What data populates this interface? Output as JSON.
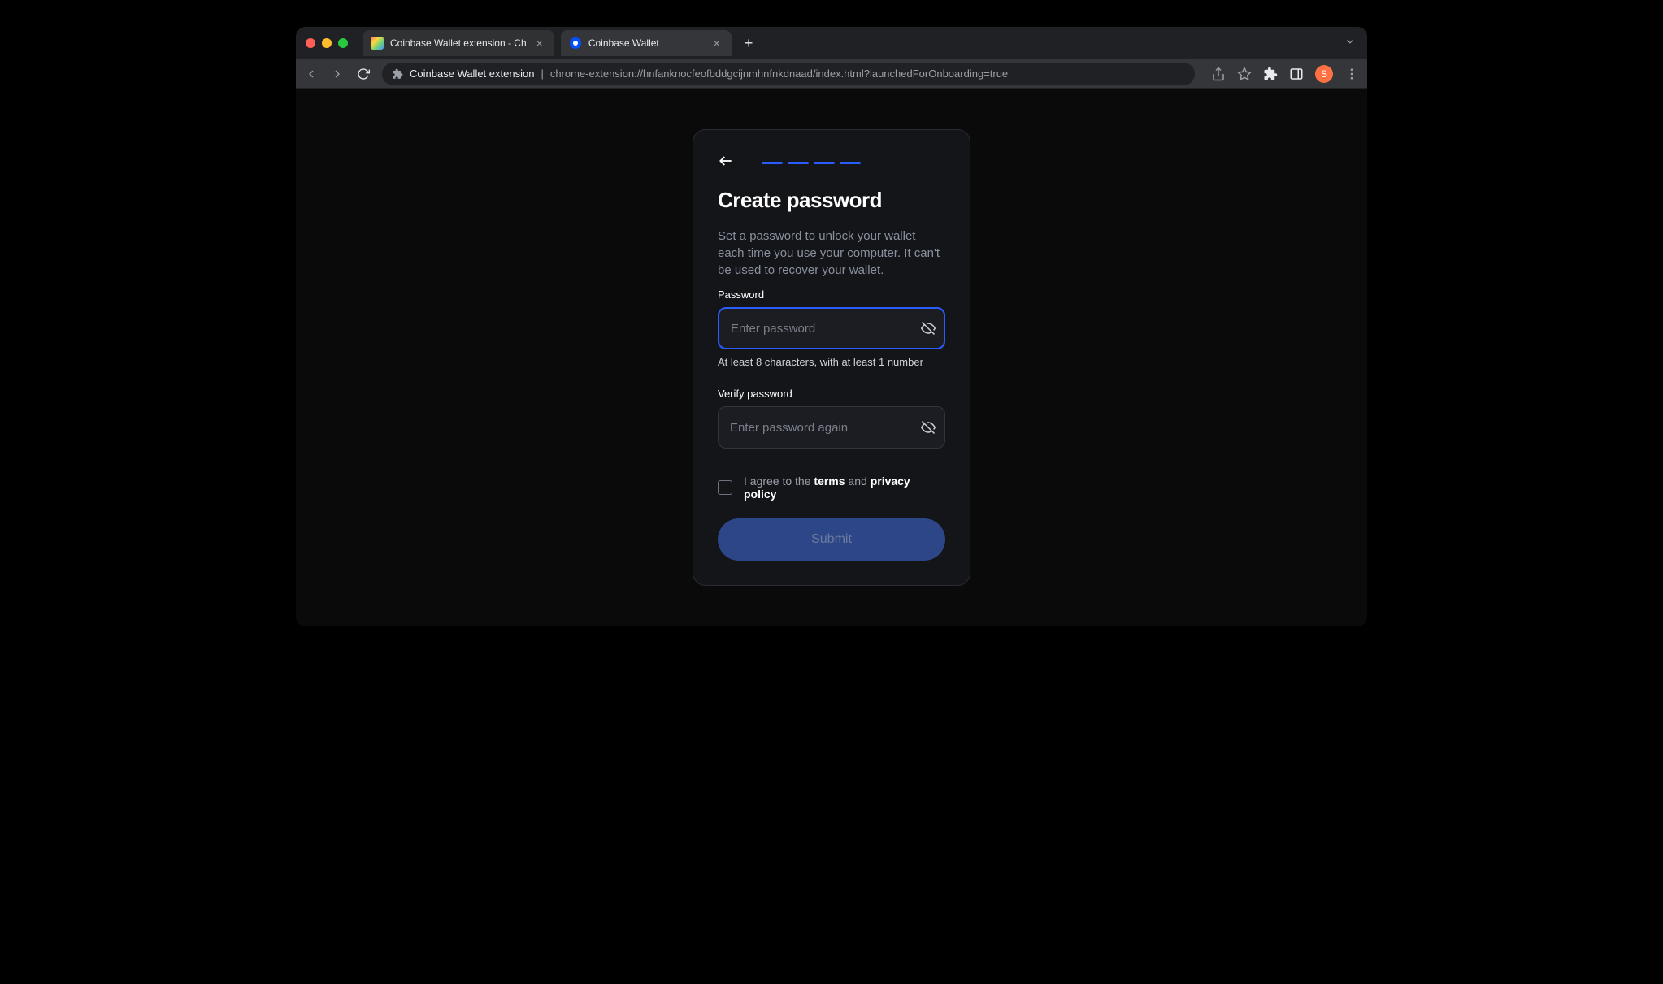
{
  "browser": {
    "tabs": [
      {
        "title": "Coinbase Wallet extension - Ch",
        "active": false
      },
      {
        "title": "Coinbase Wallet",
        "active": true
      }
    ],
    "url": {
      "site_title": "Coinbase Wallet extension",
      "separator": "|",
      "path": "chrome-extension://hnfanknocfeofbddgcijnmhnfnkdnaad/index.html?launchedForOnboarding=true"
    },
    "profile_initial": "S"
  },
  "form": {
    "title": "Create password",
    "subtitle": "Set a password to unlock your wallet each time you use your computer. It can't be used to recover your wallet.",
    "password_label": "Password",
    "password_placeholder": "Enter password",
    "password_hint": "At least 8 characters, with at least 1 number",
    "verify_label": "Verify password",
    "verify_placeholder": "Enter password again",
    "agree_prefix": "I agree to the ",
    "agree_terms": "terms",
    "agree_connector": " and ",
    "agree_privacy": "privacy policy",
    "submit_label": "Submit"
  }
}
